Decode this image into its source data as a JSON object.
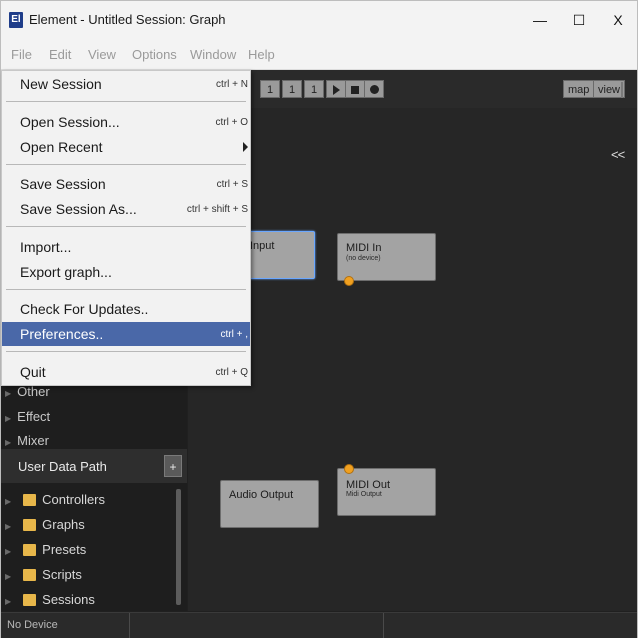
{
  "window": {
    "app_icon": "El",
    "title": "Element - Untitled Session: Graph",
    "minimize": "—",
    "maximize": "☐",
    "close": "X"
  },
  "menubar": [
    "File",
    "Edit",
    "View",
    "Options",
    "Window",
    "Help"
  ],
  "toolbar": {
    "counters": [
      "1",
      "1",
      "1"
    ],
    "map_label": "map",
    "view_label": "view"
  },
  "graph": {
    "collapse_label": "<<",
    "nodes": {
      "audio_input": {
        "title": "Input"
      },
      "midi_in": {
        "title": "MIDI In",
        "subtitle": "(no device)"
      },
      "audio_output": {
        "title": "Audio Output"
      },
      "midi_out": {
        "title": "MIDI Out",
        "subtitle": "Midi Output"
      }
    }
  },
  "sidebar": {
    "categories": [
      "Other",
      "Effect",
      "Mixer"
    ],
    "user_data_path": {
      "title": "User Data Path",
      "add_label": "+",
      "folders": [
        "Controllers",
        "Graphs",
        "Presets",
        "Scripts",
        "Sessions"
      ]
    }
  },
  "status": {
    "device": "No Device"
  },
  "file_menu": {
    "items": [
      {
        "label": "New Session",
        "shortcut": "ctrl + N"
      },
      {
        "label": "Open Session...",
        "shortcut": "ctrl + O"
      },
      {
        "label": "Open Recent",
        "shortcut": ""
      },
      {
        "label": "Save Session",
        "shortcut": "ctrl + S"
      },
      {
        "label": "Save Session As...",
        "shortcut": "ctrl + shift + S"
      },
      {
        "label": "Import...",
        "shortcut": ""
      },
      {
        "label": "Export graph...",
        "shortcut": ""
      },
      {
        "label": "Check For Updates..",
        "shortcut": ""
      },
      {
        "label": "Preferences..",
        "shortcut": "ctrl + ,"
      },
      {
        "label": "Quit",
        "shortcut": "ctrl + Q"
      }
    ]
  }
}
